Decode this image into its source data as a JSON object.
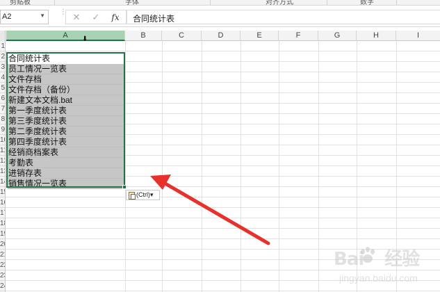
{
  "ribbon": {
    "groups": [
      "剪贴板",
      "字体",
      "对齐方式",
      "数字"
    ]
  },
  "formula_bar": {
    "name_box": "A2",
    "cancel_icon": "✕",
    "enter_icon": "✓",
    "fx_label": "fx",
    "formula_value": "合同统计表"
  },
  "columns": [
    "A",
    "B",
    "C",
    "D",
    "E",
    "F",
    "G",
    "H",
    "I"
  ],
  "selected_column": "A",
  "rows": [
    "1",
    "2",
    "3",
    "4",
    "5",
    "6",
    "7",
    "8",
    "9",
    "10",
    "11",
    "12",
    "13",
    "14",
    "15",
    "16",
    "17",
    "18",
    "19",
    "20",
    "21",
    "22",
    "23",
    "24"
  ],
  "cells_column_a": [
    "合同统计表",
    "员工情况一览表",
    "文件存档",
    "文件存档（备份）",
    "新建文本文档.bat",
    "第一季度统计表",
    "第三季度统计表",
    "第二季度统计表",
    "第四季度统计表",
    "经销商档案表",
    "考勤表",
    "进销存表",
    "销售情况一览表"
  ],
  "paste_options": {
    "label": "(Ctrl)",
    "dropdown": "▾"
  },
  "colors": {
    "selection_border": "#217346",
    "selected_header": "#a9d2b4",
    "shaded_cells": "#c6c6c6",
    "arrow": "#e8312a"
  },
  "watermark": {
    "logo_text_1": "Bai",
    "logo_text_2": "经验",
    "url": "jingyan.baidu.com"
  }
}
